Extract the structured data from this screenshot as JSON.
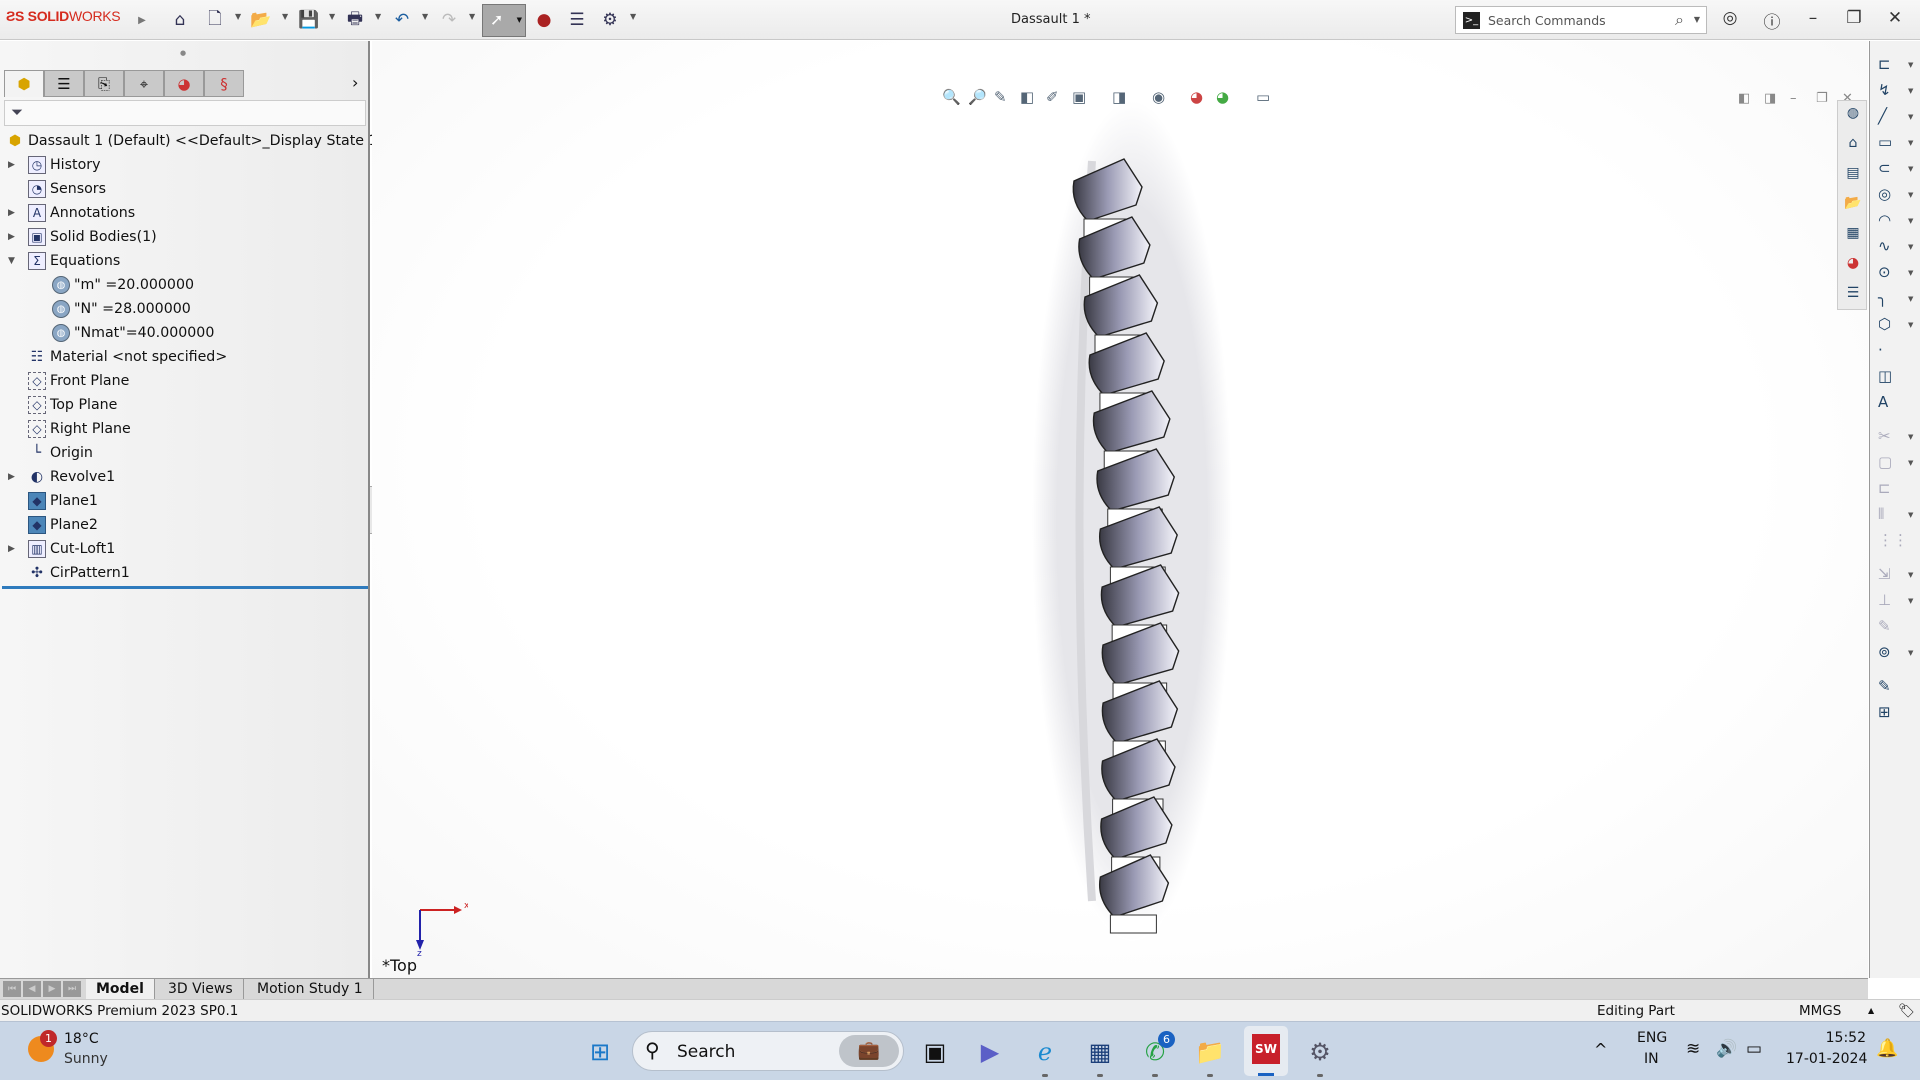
{
  "app": {
    "logo": "SOLIDWORKS",
    "title": "Dassault 1 *"
  },
  "toolbar": {
    "icons": [
      "home-icon",
      "new-document-icon",
      "open-icon",
      "save-icon",
      "print-icon",
      "undo-icon",
      "redo-icon",
      "select-icon",
      "rebuild-icon",
      "file-properties-icon",
      "options-icon"
    ]
  },
  "search": {
    "placeholder": "Search Commands"
  },
  "tree": {
    "root": "Dassault 1 (Default) <<Default>_Display State 1>",
    "items": [
      {
        "label": "History",
        "icon": "history-folder-icon",
        "expandable": true,
        "indent": 0
      },
      {
        "label": "Sensors",
        "icon": "sensors-folder-icon",
        "expandable": false,
        "indent": 0
      },
      {
        "label": "Annotations",
        "icon": "annotations-folder-icon",
        "expandable": true,
        "indent": 0
      },
      {
        "label": "Solid Bodies(1)",
        "icon": "solid-bodies-folder-icon",
        "expandable": true,
        "indent": 0
      },
      {
        "label": "Equations",
        "icon": "equations-folder-icon",
        "expandable": true,
        "expanded": true,
        "indent": 0
      },
      {
        "label": "\"m\" =20.000000",
        "icon": "global-variable-icon",
        "indent": 1
      },
      {
        "label": "\"N\" =28.000000",
        "icon": "global-variable-icon",
        "indent": 1
      },
      {
        "label": "\"Nmat\"=40.000000",
        "icon": "global-variable-icon",
        "indent": 1
      },
      {
        "label": "Material <not specified>",
        "icon": "material-icon",
        "indent": 0
      },
      {
        "label": "Front Plane",
        "icon": "plane-icon",
        "indent": 0
      },
      {
        "label": "Top Plane",
        "icon": "plane-icon",
        "indent": 0
      },
      {
        "label": "Right Plane",
        "icon": "plane-icon",
        "indent": 0
      },
      {
        "label": "Origin",
        "icon": "origin-icon",
        "indent": 0
      },
      {
        "label": "Revolve1",
        "icon": "revolve-icon",
        "expandable": true,
        "indent": 0
      },
      {
        "label": "Plane1",
        "icon": "reference-plane-icon",
        "indent": 0
      },
      {
        "label": "Plane2",
        "icon": "reference-plane-icon",
        "indent": 0
      },
      {
        "label": "Cut-Loft1",
        "icon": "cut-loft-icon",
        "expandable": true,
        "indent": 0
      },
      {
        "label": "CirPattern1",
        "icon": "circular-pattern-icon",
        "indent": 0
      }
    ]
  },
  "viewport": {
    "view_label": "*Top",
    "triad": {
      "x": "x",
      "z": "z"
    }
  },
  "bottom_tabs": [
    {
      "label": "Model",
      "active": true
    },
    {
      "label": "3D Views"
    },
    {
      "label": "Motion Study 1"
    }
  ],
  "status": {
    "version": "SOLIDWORKS Premium 2023 SP0.1",
    "mode": "Editing Part",
    "units": "MMGS"
  },
  "taskbar": {
    "weather": {
      "temp": "18°C",
      "condition": "Sunny",
      "badge": "1"
    },
    "search": "Search",
    "whatsapp_badge": "6",
    "lang": "ENG",
    "region": "IN",
    "time": "15:52",
    "date": "17-01-2024"
  },
  "colors": {
    "accent": "#2f7bbd",
    "brand": "#d52b1e"
  }
}
